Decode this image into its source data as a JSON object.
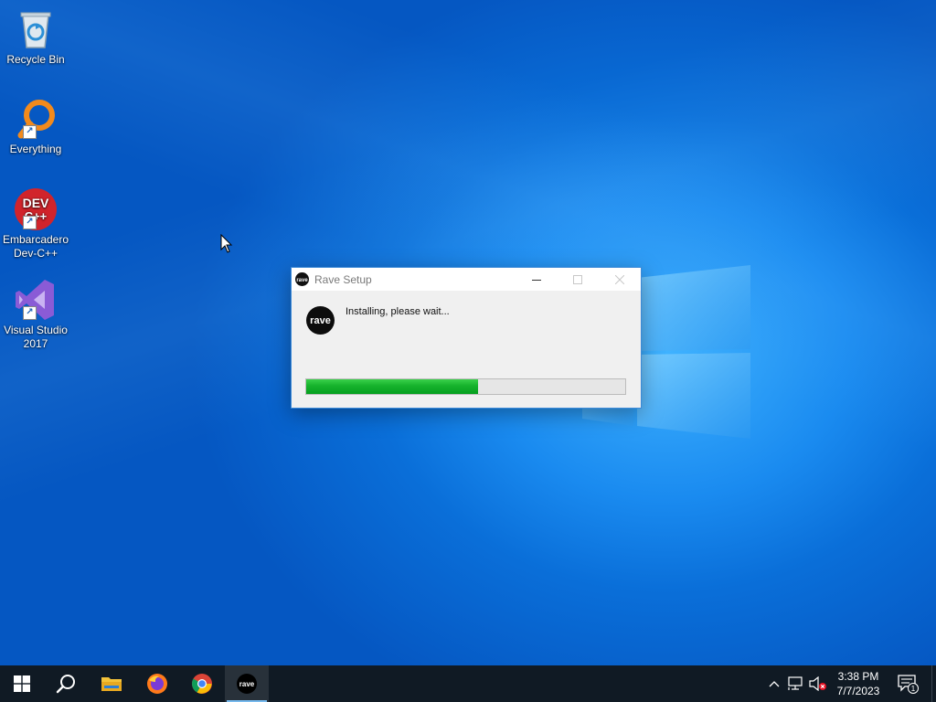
{
  "desktop": {
    "icons": [
      {
        "label": "Recycle Bin",
        "icon": "recycle-bin-icon"
      },
      {
        "label": "Everything",
        "icon": "everything-search-icon"
      },
      {
        "label": "Embarcadero Dev-C++",
        "icon": "dev-cpp-icon",
        "logo_text": "DEV C++"
      },
      {
        "label": "Visual Studio 2017",
        "icon": "visual-studio-icon"
      }
    ]
  },
  "dialog": {
    "title": "Rave Setup",
    "app_icon": "rave-logo-icon",
    "logo_text": "rave",
    "status_text": "Installing, please wait...",
    "progress_fraction": 0.54,
    "buttons": {
      "minimize": "minimize-icon",
      "maximize": "maximize-icon",
      "close": "close-icon"
    }
  },
  "taskbar": {
    "items": [
      {
        "name": "start-button",
        "icon": "windows-start-icon"
      },
      {
        "name": "search-button",
        "icon": "search-icon"
      },
      {
        "name": "file-explorer-button",
        "icon": "folder-icon"
      },
      {
        "name": "firefox-button",
        "icon": "firefox-icon"
      },
      {
        "name": "chrome-button",
        "icon": "chrome-icon"
      },
      {
        "name": "rave-button",
        "icon": "rave-logo-icon",
        "active": true
      }
    ],
    "tray": {
      "icons": [
        "chevron-up-icon",
        "network-icon",
        "volume-muted-icon"
      ],
      "time": "3:38 PM",
      "date": "7/7/2023",
      "notification_count": "1"
    }
  },
  "colors": {
    "accent": "#0a6fd9",
    "progress": "#16b22c",
    "taskbar": "#101a24",
    "active_underline": "#76b9ed"
  }
}
